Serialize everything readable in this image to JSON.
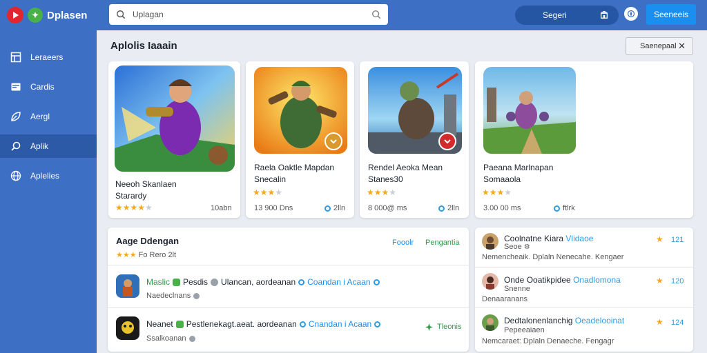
{
  "app": {
    "name": "Dplasen"
  },
  "sidebar": {
    "items": [
      {
        "label": "Leraeers",
        "icon": "table-icon"
      },
      {
        "label": "Cardis",
        "icon": "card-icon"
      },
      {
        "label": "Aergl",
        "icon": "leaf-icon"
      },
      {
        "label": "Aplik",
        "icon": "search-icon",
        "active": true
      },
      {
        "label": "Aplelies",
        "icon": "globe-icon"
      }
    ]
  },
  "topbar": {
    "search_placeholder": "Uplagan",
    "segment_label": "Segeri",
    "primary_label": "Seeneeis"
  },
  "header": {
    "title": "Aplolis Iaaain",
    "filter_label": "Saenepaal"
  },
  "cards": [
    {
      "title1": "Neeoh Skanlaen",
      "title2": "Starardy",
      "rating": 4,
      "meta": "",
      "side": "10abn"
    },
    {
      "title1": "Raela Oaktle Mapdan",
      "title2": "Snecalin",
      "rating": 3,
      "meta": "13 900 Dns",
      "side": "2lln"
    },
    {
      "title1": "Rendel Aeoka Mean",
      "title2": "Stanes30",
      "rating": 3,
      "meta": "8 000@ ms",
      "side": "2lln"
    },
    {
      "title1": "Paeana Marlnapan",
      "title2": "Somaaola",
      "rating": 3,
      "meta": "3.00 00 ms",
      "side": "ftlrk"
    }
  ],
  "list": {
    "title": "Aage Ddengan",
    "subtitle": "Fo Rero 2lt",
    "link1": "Fooolr",
    "link2": "Pengantia",
    "rows": [
      {
        "name": "Maslic",
        "tag1": "Pesdis",
        "tag2": "Ulancan, aordeanan",
        "link": "Coandan i Acaan",
        "sub": "Naedeclnans"
      },
      {
        "name": "Neanet",
        "tag1": "Pestlenekagt.aeat. aordeanan",
        "tag2": "",
        "link": "Cnandan i Acaan",
        "sub": "Ssalkoanan"
      }
    ],
    "action": "Tleonis"
  },
  "reviews": [
    {
      "name": "Coolnatne Kiara",
      "tag": "Vlidaoe",
      "sub": "Seoe",
      "desc": "Nemencheaik. Dplaln Nenecahe. Kengaer",
      "count": "121"
    },
    {
      "name": "Onde Ooatikpidee",
      "tag": "Onadlomona",
      "sub": "Snenne",
      "desc": "Denaaranans",
      "count": "120"
    },
    {
      "name": "Dedtalonenlanchig",
      "tag": "Oeadelooinat",
      "sub": "Pepeeaiaen",
      "desc": "Nemcaraet: Dplaln Denaeche. Fengagr",
      "count": "124"
    }
  ],
  "colors": {
    "sidebar": "#3d6fc4",
    "accent": "#1b8ff0",
    "star": "#f2a81f",
    "success": "#2e9b4a"
  }
}
